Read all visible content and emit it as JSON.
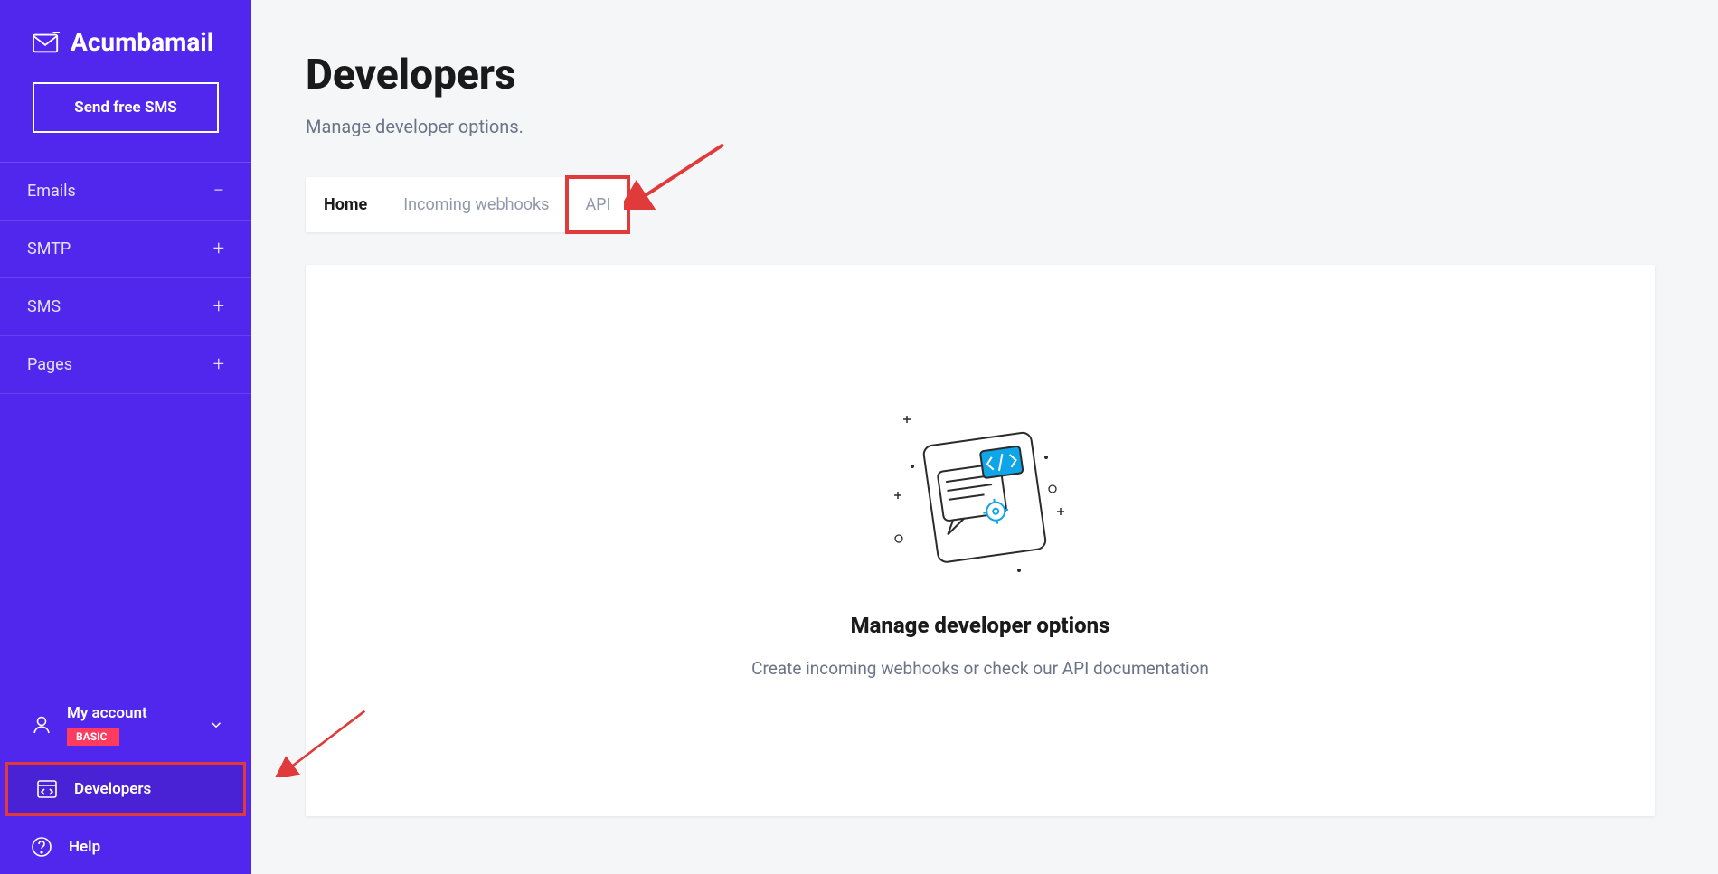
{
  "brand": {
    "name": "Acumbamail"
  },
  "sidebar": {
    "cta": "Send free SMS",
    "nav": [
      {
        "label": "Emails",
        "toggle": "minus"
      },
      {
        "label": "SMTP",
        "toggle": "plus"
      },
      {
        "label": "SMS",
        "toggle": "plus"
      },
      {
        "label": "Pages",
        "toggle": "plus"
      }
    ],
    "account": {
      "label": "My account",
      "badge": "BASIC"
    },
    "developers": "Developers",
    "help": "Help"
  },
  "page": {
    "title": "Developers",
    "subtitle": "Manage developer options.",
    "tabs": [
      {
        "label": "Home",
        "active": true
      },
      {
        "label": "Incoming webhooks",
        "active": false
      },
      {
        "label": "API",
        "active": false,
        "highlight": true
      }
    ],
    "card": {
      "title": "Manage developer options",
      "subtitle": "Create incoming webhooks or check our API documentation"
    }
  }
}
